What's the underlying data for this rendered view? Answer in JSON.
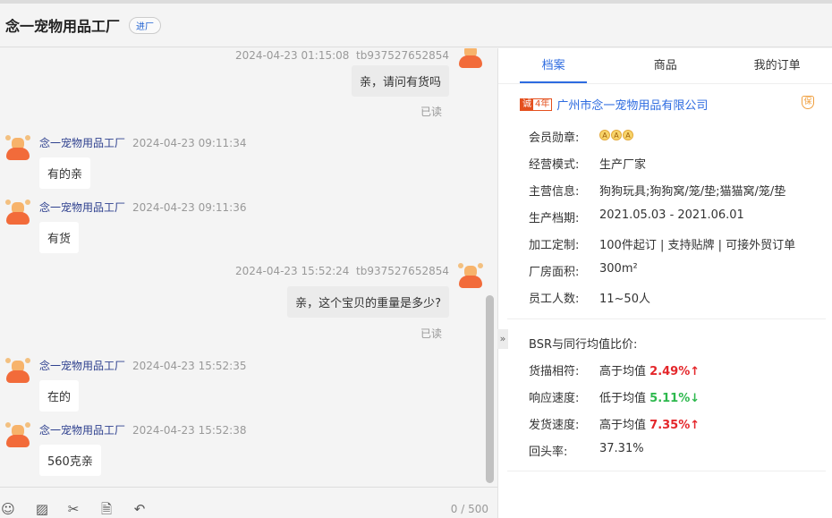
{
  "header": {
    "title": "念一宠物用品工厂",
    "badge": "进厂"
  },
  "messages": [
    {
      "sender": "tb937527652854",
      "time": "2024-04-23 01:15:08",
      "text": "亲，请问有货吗",
      "read": "已读"
    },
    {
      "sender": "念一宠物用品工厂",
      "time": "2024-04-23 09:11:34",
      "text": "有的亲"
    },
    {
      "sender": "念一宠物用品工厂",
      "time": "2024-04-23 09:11:36",
      "text": "有货"
    },
    {
      "sender": "tb937527652854",
      "time": "2024-04-23 15:52:24",
      "text": "亲，这个宝贝的重量是多少?",
      "read": "已读"
    },
    {
      "sender": "念一宠物用品工厂",
      "time": "2024-04-23 15:52:35",
      "text": "在的"
    },
    {
      "sender": "念一宠物用品工厂",
      "time": "2024-04-23 15:52:38",
      "text": "560克亲"
    }
  ],
  "input": {
    "count": "0 / 500",
    "tools": [
      "emoji-icon",
      "image-icon",
      "scissors-icon",
      "document-icon",
      "quick-reply-icon"
    ]
  },
  "panel": {
    "tabs": [
      "档案",
      "商品",
      "我的订单"
    ],
    "company": {
      "badge_a": "诚",
      "badge_b": "4年",
      "name": "广州市念一宠物用品有限公司",
      "shield": "保"
    },
    "rows": [
      {
        "k": "会员勋章:",
        "v": ""
      },
      {
        "k": "经营模式:",
        "v": "生产厂家"
      },
      {
        "k": "主营信息:",
        "v": "狗狗玩具;狗狗窝/笼/垫;猫猫窝/笼/垫"
      },
      {
        "k": "生产档期:",
        "v": "2021.05.03 - 2021.06.01"
      },
      {
        "k": "加工定制:",
        "v": "100件起订 | 支持贴牌 | 可接外贸订单"
      },
      {
        "k": "厂房面积:",
        "v": "300m²"
      },
      {
        "k": "员工人数:",
        "v": "11~50人"
      }
    ],
    "bsr_title": "BSR与同行均值比价:",
    "bsr": [
      {
        "k": "货描相符:",
        "v": "高于均值",
        "pct": "2.49%",
        "arrow": "↑"
      },
      {
        "k": "响应速度:",
        "v": "低于均值",
        "pct": "5.11%",
        "arrow": "↓"
      },
      {
        "k": "发货速度:",
        "v": "高于均值",
        "pct": "7.35%",
        "arrow": "↑"
      },
      {
        "k": "回头率:",
        "v": "37.31%"
      }
    ]
  }
}
